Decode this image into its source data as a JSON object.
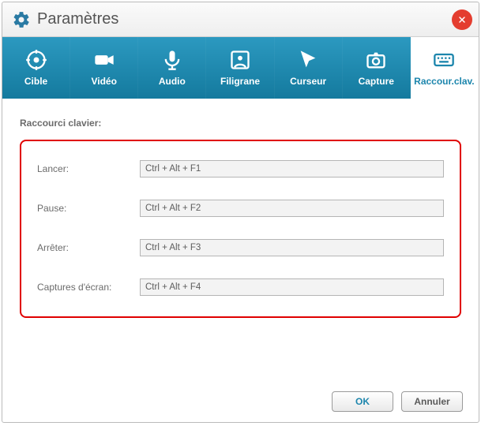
{
  "window": {
    "title": "Paramètres"
  },
  "tabs": [
    {
      "id": "cible",
      "label": "Cible"
    },
    {
      "id": "video",
      "label": "Vidéo"
    },
    {
      "id": "audio",
      "label": "Audio"
    },
    {
      "id": "filigrane",
      "label": "Filigrane"
    },
    {
      "id": "curseur",
      "label": "Curseur"
    },
    {
      "id": "capture",
      "label": "Capture"
    },
    {
      "id": "raccourci",
      "label": "Raccour.clav."
    }
  ],
  "active_tab": "raccourci",
  "section": {
    "title": "Raccourci clavier:"
  },
  "shortcuts": {
    "lancer": {
      "label": "Lancer:",
      "value": "Ctrl + Alt + F1"
    },
    "pause": {
      "label": "Pause:",
      "value": "Ctrl + Alt + F2"
    },
    "arreter": {
      "label": "Arrêter:",
      "value": "Ctrl + Alt + F3"
    },
    "captures": {
      "label": "Captures d'écran:",
      "value": "Ctrl + Alt + F4"
    }
  },
  "footer": {
    "ok": "OK",
    "cancel": "Annuler"
  },
  "colors": {
    "accent": "#1d86ad",
    "close": "#e43d2f",
    "highlight_border": "#e00000"
  }
}
